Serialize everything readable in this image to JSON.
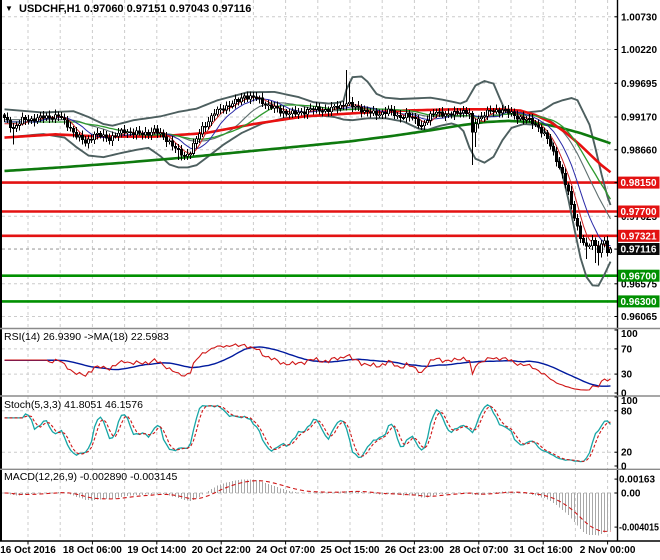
{
  "header": {
    "symbol_ohlc": "USDCHF,H1 0.97060 0.97151 0.97043 0.97116",
    "dropdown_icon": "▼"
  },
  "indicator_headers": {
    "rsi": "RSI(14) 26.9390 ->MA(18) 22.5983",
    "stoch": "Stoch(5,3,3) 41.8051 46.1576",
    "macd": "MACD(12,26,9) -0.002890 -0.003145"
  },
  "chart_data": {
    "type": "candlestick",
    "symbol": "USDCHF",
    "timeframe": "H1",
    "current_bar": {
      "open": 0.9706,
      "high": 0.97151,
      "low": 0.97043,
      "close": 0.97116
    },
    "price_scale": [
      {
        "p": 1.0073,
        "label": "1.00730",
        "show": true
      },
      {
        "p": 1.0022,
        "label": "1.00220",
        "show": true
      },
      {
        "p": 0.99695,
        "label": "0.99695",
        "show": true
      },
      {
        "p": 0.9917,
        "label": "0.99170",
        "show": true
      },
      {
        "p": 0.9866,
        "label": "0.98660",
        "show": true
      },
      {
        "p": 0.9815,
        "label": "0.98150",
        "show": false
      },
      {
        "p": 0.97625,
        "label": "0.97625",
        "show": true
      },
      {
        "p": 0.97115,
        "label": "0.97115",
        "show": false
      },
      {
        "p": 0.96575,
        "label": "0.96575",
        "show": true
      },
      {
        "p": 0.96065,
        "label": "0.96065",
        "show": true
      }
    ],
    "time_labels": [
      "16 Oct 2016",
      "18 Oct 06:00",
      "19 Oct 14:00",
      "20 Oct 22:00",
      "24 Oct 07:00",
      "25 Oct 15:00",
      "26 Oct 23:00",
      "28 Oct 07:00",
      "31 Oct 16:00",
      "2 Nov 00:00"
    ],
    "hlines": [
      {
        "price": 0.9815,
        "color": "#e31212",
        "kind": "resistance"
      },
      {
        "price": 0.977,
        "color": "#e31212",
        "kind": "resistance"
      },
      {
        "price": 0.97321,
        "color": "#e31212",
        "kind": "resistance"
      },
      {
        "price": 0.967,
        "color": "#009001",
        "kind": "support"
      },
      {
        "price": 0.963,
        "color": "#009001",
        "kind": "support"
      }
    ],
    "bid_line": {
      "price": 0.97116
    },
    "axis_badges": [
      {
        "label": "0.98150",
        "price": 0.9815,
        "type": "red"
      },
      {
        "label": "0.97700",
        "price": 0.977,
        "type": "red"
      },
      {
        "label": "0.97321",
        "price": 0.97321,
        "type": "red"
      },
      {
        "label": "0.97116",
        "price": 0.97116,
        "type": "black"
      },
      {
        "label": "0.96700",
        "price": 0.967,
        "type": "green"
      },
      {
        "label": "0.96300",
        "price": 0.963,
        "type": "green"
      }
    ],
    "close_waypoints": [
      [
        0,
        0.99145
      ],
      [
        3,
        0.99
      ],
      [
        6,
        0.9912
      ],
      [
        12,
        0.99155
      ],
      [
        18,
        0.9919
      ],
      [
        22,
        0.99
      ],
      [
        24,
        0.9888
      ],
      [
        27,
        0.9877
      ],
      [
        30,
        0.989
      ],
      [
        35,
        0.9884
      ],
      [
        40,
        0.9895
      ],
      [
        46,
        0.989
      ],
      [
        50,
        0.9896
      ],
      [
        55,
        0.9879
      ],
      [
        58,
        0.9862
      ],
      [
        60,
        0.9856
      ],
      [
        62,
        0.9864
      ],
      [
        66,
        0.99
      ],
      [
        70,
        0.9923
      ],
      [
        74,
        0.9934
      ],
      [
        78,
        0.9942
      ],
      [
        80,
        0.995
      ],
      [
        84,
        0.9946
      ],
      [
        88,
        0.9935
      ],
      [
        92,
        0.9926
      ],
      [
        97,
        0.9922
      ],
      [
        102,
        0.9929
      ],
      [
        108,
        0.9928
      ],
      [
        112,
        0.9934
      ],
      [
        114,
        0.994
      ],
      [
        116,
        0.9933
      ],
      [
        118,
        0.9931
      ],
      [
        121,
        0.9925
      ],
      [
        124,
        0.9921
      ],
      [
        128,
        0.9927
      ],
      [
        131,
        0.9918
      ],
      [
        134,
        0.992
      ],
      [
        137,
        0.9912
      ],
      [
        139,
        0.9904
      ],
      [
        141,
        0.9913
      ],
      [
        144,
        0.9926
      ],
      [
        148,
        0.9919
      ],
      [
        152,
        0.9927
      ],
      [
        155,
        0.9921
      ],
      [
        156,
        0.989
      ],
      [
        157,
        0.991
      ],
      [
        158,
        0.9915
      ],
      [
        162,
        0.9926
      ],
      [
        166,
        0.9928
      ],
      [
        172,
        0.9916
      ],
      [
        176,
        0.9909
      ],
      [
        178,
        0.9902
      ],
      [
        181,
        0.9882
      ],
      [
        184,
        0.9852
      ],
      [
        186,
        0.9827
      ],
      [
        188,
        0.9798
      ],
      [
        190,
        0.9763
      ],
      [
        192,
        0.973
      ],
      [
        194,
        0.9712
      ],
      [
        196,
        0.9725
      ],
      [
        198,
        0.971
      ],
      [
        200,
        0.9723
      ],
      [
        201,
        0.9706
      ],
      [
        202,
        0.97116
      ]
    ],
    "spikes": [
      {
        "b": 3,
        "l": 0.9874
      },
      {
        "b": 58,
        "l": 0.985
      },
      {
        "b": 59,
        "l": 0.9849
      },
      {
        "b": 114,
        "h": 0.999
      },
      {
        "b": 115,
        "h": 0.9972
      },
      {
        "b": 156,
        "l": 0.9842
      },
      {
        "b": 157,
        "l": 0.987
      },
      {
        "b": 194,
        "l": 0.9696
      },
      {
        "b": 197,
        "l": 0.969
      },
      {
        "b": 198,
        "l": 0.9686
      }
    ],
    "bb_upper_waypoints": [
      [
        0,
        0.9929
      ],
      [
        13,
        0.9924
      ],
      [
        23,
        0.9926
      ],
      [
        28,
        0.9917
      ],
      [
        33,
        0.9906
      ],
      [
        36,
        0.99035
      ],
      [
        43,
        0.9912
      ],
      [
        52,
        0.9918
      ],
      [
        58,
        0.9925
      ],
      [
        64,
        0.993
      ],
      [
        71,
        0.9943
      ],
      [
        81,
        0.99555
      ],
      [
        90,
        0.9956
      ],
      [
        98,
        0.9948
      ],
      [
        103,
        0.994
      ],
      [
        108,
        0.9938
      ],
      [
        111,
        0.9939
      ],
      [
        113,
        0.9942
      ],
      [
        114,
        0.996
      ],
      [
        116,
        0.9979
      ],
      [
        119,
        0.998
      ],
      [
        121,
        0.9972
      ],
      [
        124,
        0.9953
      ],
      [
        127,
        0.9947
      ],
      [
        132,
        0.9945
      ],
      [
        137,
        0.9946
      ],
      [
        142,
        0.9947
      ],
      [
        146,
        0.9944
      ],
      [
        150,
        0.994
      ],
      [
        152,
        0.9938
      ],
      [
        154,
        0.9942
      ],
      [
        157,
        0.9966
      ],
      [
        160,
        0.9973
      ],
      [
        163,
        0.9969
      ],
      [
        165,
        0.9947
      ],
      [
        167,
        0.9926
      ],
      [
        170,
        0.99225
      ],
      [
        175,
        0.99245
      ],
      [
        179,
        0.99265
      ],
      [
        181,
        0.9932
      ],
      [
        183,
        0.9938
      ],
      [
        186,
        0.9943
      ],
      [
        189,
        0.99465
      ],
      [
        191,
        0.9943
      ],
      [
        193,
        0.9924
      ],
      [
        195,
        0.9905
      ],
      [
        197,
        0.9868
      ],
      [
        199,
        0.9828
      ],
      [
        201,
        0.9793
      ],
      [
        202,
        0.978
      ]
    ],
    "bb_lower_waypoints": [
      [
        0,
        0.9885
      ],
      [
        13,
        0.98905
      ],
      [
        20,
        0.9885
      ],
      [
        24,
        0.987
      ],
      [
        28,
        0.9857
      ],
      [
        33,
        0.98545
      ],
      [
        38,
        0.986
      ],
      [
        44,
        0.9866
      ],
      [
        48,
        0.9869
      ],
      [
        52,
        0.9856
      ],
      [
        55,
        0.9843
      ],
      [
        58,
        0.98385
      ],
      [
        61,
        0.98385
      ],
      [
        64,
        0.9842
      ],
      [
        68,
        0.9856
      ],
      [
        73,
        0.9874
      ],
      [
        79,
        0.9892
      ],
      [
        86,
        0.9907
      ],
      [
        93,
        0.9915
      ],
      [
        100,
        0.9918
      ],
      [
        106,
        0.9919
      ],
      [
        110,
        0.9917
      ],
      [
        113,
        0.9913
      ],
      [
        116,
        0.9912
      ],
      [
        121,
        0.9915
      ],
      [
        127,
        0.9915
      ],
      [
        133,
        0.991
      ],
      [
        138,
        0.9899
      ],
      [
        141,
        0.9897
      ],
      [
        145,
        0.9903
      ],
      [
        149,
        0.9907
      ],
      [
        151,
        0.9904
      ],
      [
        153,
        0.9895
      ],
      [
        155,
        0.9869
      ],
      [
        157,
        0.9852
      ],
      [
        160,
        0.9846
      ],
      [
        163,
        0.9855
      ],
      [
        166,
        0.9881
      ],
      [
        169,
        0.99
      ],
      [
        173,
        0.9906
      ],
      [
        177,
        0.9905
      ],
      [
        180,
        0.9895
      ],
      [
        182,
        0.9884
      ],
      [
        184,
        0.9858
      ],
      [
        186,
        0.9827
      ],
      [
        188,
        0.9788
      ],
      [
        190,
        0.9742
      ],
      [
        192,
        0.9698
      ],
      [
        194,
        0.9668
      ],
      [
        196,
        0.9655
      ],
      [
        198,
        0.96545
      ],
      [
        200,
        0.9672
      ],
      [
        202,
        0.9692
      ]
    ],
    "ma_red_waypoints": [
      [
        0,
        0.9885
      ],
      [
        17,
        0.989
      ],
      [
        33,
        0.98865
      ],
      [
        50,
        0.98865
      ],
      [
        67,
        0.9892
      ],
      [
        83,
        0.9906
      ],
      [
        100,
        0.9918
      ],
      [
        117,
        0.9923
      ],
      [
        133,
        0.9927
      ],
      [
        150,
        0.9929
      ],
      [
        165,
        0.9929
      ],
      [
        172,
        0.9927
      ],
      [
        177,
        0.992
      ],
      [
        182,
        0.9909
      ],
      [
        187,
        0.9893
      ],
      [
        192,
        0.9873
      ],
      [
        196,
        0.9855
      ],
      [
        199,
        0.9842
      ],
      [
        202,
        0.9831
      ]
    ],
    "ma_green_waypoints": [
      [
        0,
        0.9833
      ],
      [
        20,
        0.9839
      ],
      [
        40,
        0.9846
      ],
      [
        60,
        0.9854
      ],
      [
        80,
        0.9863
      ],
      [
        100,
        0.9872
      ],
      [
        115,
        0.9879
      ],
      [
        130,
        0.9888
      ],
      [
        143,
        0.9897
      ],
      [
        152,
        0.9904
      ],
      [
        160,
        0.9909
      ],
      [
        168,
        0.9911
      ],
      [
        176,
        0.9909
      ],
      [
        184,
        0.9902
      ],
      [
        192,
        0.9892
      ],
      [
        202,
        0.9876
      ]
    ],
    "rsi": {
      "period": 14,
      "value": 26.939,
      "ma_period": 18,
      "ma_value": 22.5983,
      "ticks": [
        {
          "v": 100,
          "label": "100"
        },
        {
          "v": 70,
          "label": "70"
        },
        {
          "v": 30,
          "label": "30"
        },
        {
          "v": 0,
          "label": "0"
        }
      ],
      "levels": [
        70,
        30
      ]
    },
    "stoch": {
      "k": 5,
      "d": 3,
      "slowing": 3,
      "main_value": 41.8051,
      "signal_value": 46.1576,
      "ticks": [
        {
          "v": 100,
          "label": "100"
        },
        {
          "v": 80,
          "label": "80"
        },
        {
          "v": 20,
          "label": "20"
        },
        {
          "v": 0,
          "label": "0"
        }
      ],
      "levels": [
        80,
        20
      ]
    },
    "macd": {
      "fast": 12,
      "slow": 26,
      "signal": 9,
      "value": -0.00289,
      "signal_value": -0.003145,
      "ticks": [
        {
          "v": 0.00163,
          "label": "0.00163"
        },
        {
          "v": 0,
          "label": "0.00"
        },
        {
          "v": -0.004015,
          "label": "-0.004015"
        }
      ]
    },
    "colors": {
      "grid": "#cccccc",
      "bollinger": "#4d5f5f",
      "ma_red": "#e81010",
      "ma_green": "#0e7a0e",
      "ma_thin_red": "#cc2222",
      "ma_thin_blue": "#2a2aa8",
      "ma_thin_green": "#2e9a2e",
      "ma_mid_gray": "#5e6f6f",
      "candle": "#000000",
      "hline_red": "#e31212",
      "hline_green": "#009001",
      "badge_red": "#e31212",
      "badge_green": "#009001",
      "badge_black": "#0a0a0a",
      "bid_dash": "#9b9b9b",
      "rsi_line": "#cf1717",
      "rsi_ma": "#001a9e",
      "stoch_main": "#17a6a6",
      "stoch_signal": "#cf1717",
      "macd_hist": "#a8a8a8",
      "macd_signal": "#cf1717"
    }
  }
}
